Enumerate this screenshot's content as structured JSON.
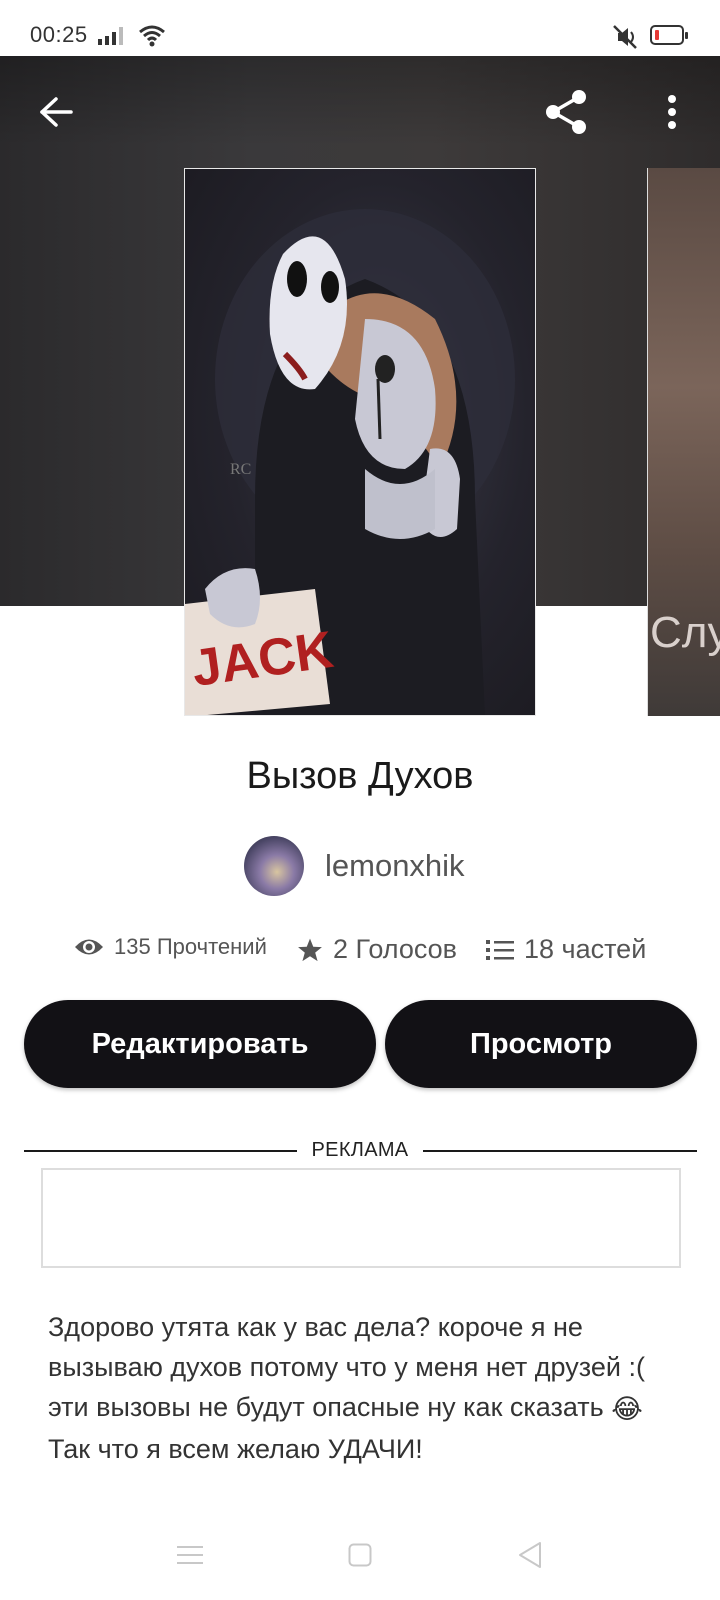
{
  "status_bar": {
    "time": "00:25",
    "icons": [
      "signal-icon",
      "wifi-icon",
      "mute-icon",
      "battery-low-icon"
    ],
    "battery_color": "#e53935"
  },
  "toolbar": {
    "back_icon": "arrow-left-icon",
    "share_icon": "share-icon",
    "more_icon": "more-vertical-icon"
  },
  "cover": {
    "image_text": "JACK",
    "signature": "RC",
    "next_cover_text": "Слу"
  },
  "story": {
    "title": "Вызов Духов",
    "author": "lemonxhik"
  },
  "stats": {
    "reads": "135 Прочтений",
    "votes": "2 Голосов",
    "parts": "18 частей"
  },
  "buttons": {
    "edit": "Редактировать",
    "view": "Просмотр"
  },
  "ad": {
    "label": "РЕКЛАМА"
  },
  "description": {
    "text_before_emoji": "Здорово утята как у вас дела? короче я не вызываю духов потому что у меня нет друзей :(  эти вызовы не будут опасные ну как сказать ",
    "emoji": "😂",
    "text_after_emoji": " Так что я всем желаю УДАЧИ!"
  },
  "nav_bar": {
    "icons": [
      "menu-icon",
      "home-square-icon",
      "back-triangle-icon"
    ]
  },
  "colors": {
    "button_bg": "#121115",
    "button_text": "#ffffff",
    "hero_bg": "#363537"
  }
}
